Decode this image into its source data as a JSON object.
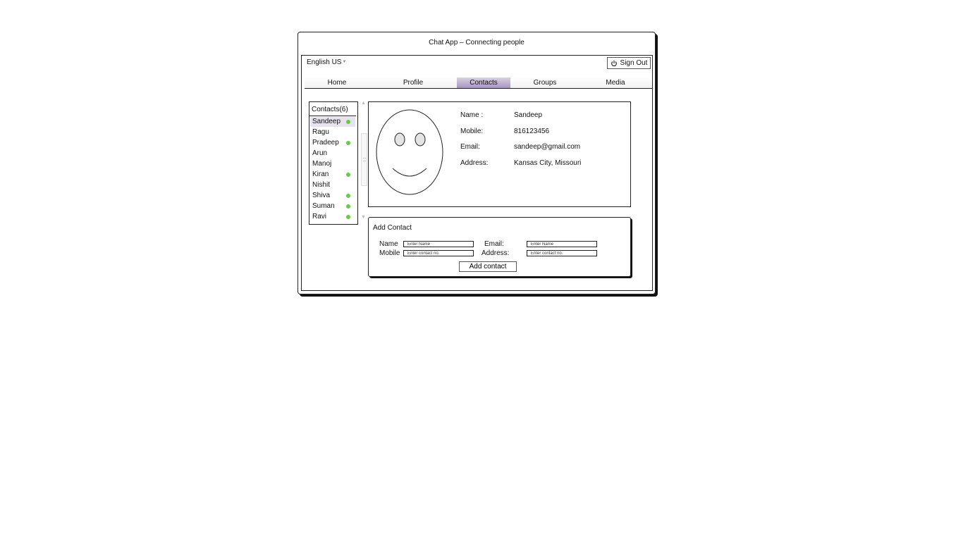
{
  "window": {
    "title": "Chat App – Connecting people"
  },
  "header": {
    "language": "English US",
    "sign_out_label": "Sign Out"
  },
  "nav": {
    "tabs": [
      {
        "label": "Home",
        "active": false
      },
      {
        "label": "Profile",
        "active": false
      },
      {
        "label": "Contacts",
        "active": true
      },
      {
        "label": "Groups",
        "active": false
      },
      {
        "label": "Media",
        "active": false
      }
    ]
  },
  "contacts": {
    "header": "Contacts(6)",
    "items": [
      {
        "name": "Sandeep",
        "online": true,
        "selected": true
      },
      {
        "name": "Ragu",
        "online": false
      },
      {
        "name": "Pradeep",
        "online": true
      },
      {
        "name": "Arun",
        "online": false
      },
      {
        "name": "Manoj",
        "online": false
      },
      {
        "name": "Kiran",
        "online": true
      },
      {
        "name": "Nishit",
        "online": false
      },
      {
        "name": "Shiva",
        "online": true
      },
      {
        "name": "Suman",
        "online": true
      },
      {
        "name": "Ravi",
        "online": true
      }
    ]
  },
  "detail": {
    "name_label": "Name :",
    "name_value": "Sandeep",
    "mobile_label": "Mobile:",
    "mobile_value": "816123456",
    "email_label": "Email:",
    "email_value": "sandeep@gmail.com",
    "address_label": "Address:",
    "address_value": "Kansas City, Missouri"
  },
  "add_contact": {
    "title": "Add Contact",
    "name_label": "Name",
    "name_placeholder": "Enter Name",
    "email_label": "Email:",
    "email_placeholder": "Enter Name",
    "mobile_label": "Mobile",
    "mobile_placeholder": "Enter contact no.",
    "address_label": "Address:",
    "address_placeholder": "Enter contact no.",
    "button_label": "Add contact"
  },
  "colors": {
    "online": "#66cc44",
    "active_tab": "#a796bc",
    "selected_row": "#e7e2ee"
  }
}
